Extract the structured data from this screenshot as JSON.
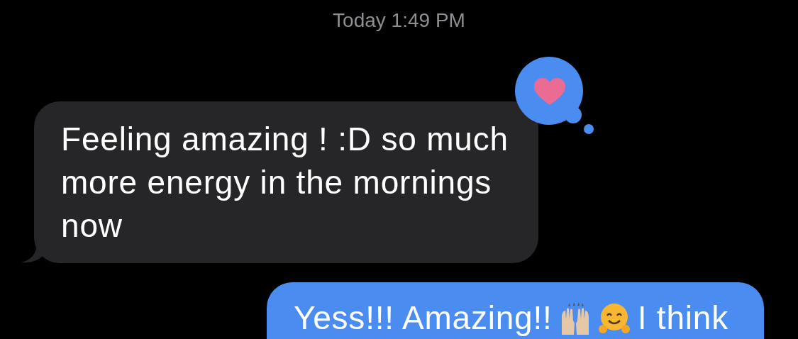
{
  "timestamp": "Today 1:49 PM",
  "messages": [
    {
      "kind": "received",
      "text": "Feeling amazing ! :D so much\nmore energy in the mornings\nnow",
      "reaction": {
        "kind": "heart"
      }
    },
    {
      "kind": "sent",
      "parts": [
        {
          "kind": "text",
          "text": "Yess!!! Amazing!!"
        },
        {
          "kind": "raised-hands"
        },
        {
          "kind": "hugging-face"
        },
        {
          "kind": "text",
          "text": "I think"
        }
      ]
    }
  ]
}
